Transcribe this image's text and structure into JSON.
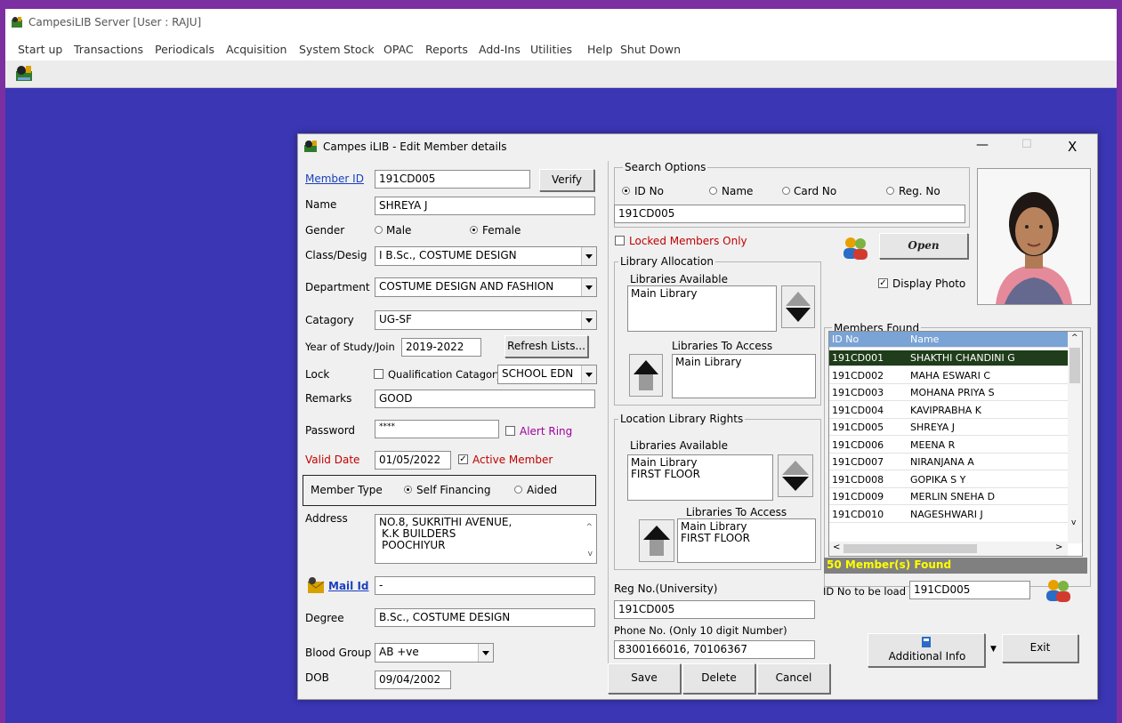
{
  "app": {
    "title": "CampesiLIB Server  [User : RAJU]"
  },
  "menu": [
    "Start up",
    "Transactions",
    "Periodicals",
    "Acquisition",
    "System",
    "Stock",
    "OPAC",
    "Reports",
    "Add-Ins",
    "Utilities",
    "Help",
    "Shut Down"
  ],
  "dialog": {
    "title": "Campes iLIB - Edit Member details",
    "window_controls": {
      "minimize": "—",
      "maximize": "☐",
      "close": "X"
    }
  },
  "form": {
    "member_id_label": "Member ID",
    "member_id": "191CD005",
    "verify_button": "Verify",
    "name_label": "Name",
    "name": "SHREYA  J",
    "gender_label": "Gender",
    "gender_options": [
      "Male",
      "Female"
    ],
    "gender_selected": "Female",
    "class_label": "Class/Desig",
    "class_value": "I B.Sc., COSTUME DESIGN",
    "department_label": "Department",
    "department_value": "COSTUME DESIGN AND FASHION",
    "category_label": "Catagory",
    "category_value": "UG-SF",
    "year_label": "Year of Study/Join",
    "year_value": "2019-2022",
    "refresh_button": "Refresh Lists...",
    "lock_label": "Lock",
    "qualification_label": "Qualification Catagory",
    "qualification_value": "SCHOOL EDN",
    "remarks_label": "Remarks",
    "remarks_value": "GOOD",
    "password_label": "Password",
    "password_value": "****",
    "alert_ring_label": "Alert Ring",
    "valid_date_label": "Valid Date",
    "valid_date_value": "01/05/2022",
    "active_member_label": "Active Member",
    "member_type_label": "Member Type",
    "member_type_options": [
      "Self Financing",
      "Aided"
    ],
    "member_type_selected": "Self Financing",
    "address_label": "Address",
    "address_lines": [
      "NO.8, SUKRITHI AVENUE,",
      "K.K BUILDERS",
      "POOCHIYUR"
    ],
    "mail_label": "Mail Id",
    "mail_value": "-",
    "degree_label": "Degree",
    "degree_value": "B.Sc., COSTUME DESIGN",
    "blood_label": "Blood Group",
    "blood_value": "AB +ve",
    "dob_label": "DOB",
    "dob_value": "09/04/2002"
  },
  "search": {
    "group_title": "Search Options",
    "options": [
      "ID No",
      "Name",
      "Card No",
      "Reg. No"
    ],
    "selected": "ID No",
    "query": "191CD005",
    "locked_only_label": "Locked Members Only",
    "open_button": "Open",
    "display_photo_label": "Display Photo"
  },
  "library_allocation": {
    "group_title": "Library Allocation",
    "available_label": "Libraries Available",
    "available": [
      "Main Library"
    ],
    "access_label": "Libraries To Access",
    "access": [
      "Main Library"
    ]
  },
  "location_rights": {
    "group_title": "Location Library Rights",
    "available_label": "Libraries Available",
    "available": [
      "Main Library",
      "FIRST FLOOR"
    ],
    "access_label": "Libraries To Access",
    "access": [
      "Main Library",
      "FIRST FLOOR"
    ]
  },
  "reg_no_label": "Reg No.(University)",
  "reg_no_value": "191CD005",
  "phone_label": "Phone No. (Only 10 digit Number)",
  "phone_value": "8300166016, 70106367",
  "buttons": {
    "save": "Save",
    "delete": "Delete",
    "cancel": "Cancel",
    "additional_info": "Additional Info",
    "exit": "Exit"
  },
  "members": {
    "group_title": "Members Found",
    "columns": [
      "ID No",
      "Name"
    ],
    "rows": [
      [
        "191CD001",
        "SHAKTHI CHANDINI G"
      ],
      [
        "191CD002",
        "MAHA ESWARI C"
      ],
      [
        "191CD003",
        "MOHANA PRIYA S"
      ],
      [
        "191CD004",
        "KAVIPRABHA K"
      ],
      [
        "191CD005",
        "SHREYA  J"
      ],
      [
        "191CD006",
        "MEENA R"
      ],
      [
        "191CD007",
        "NIRANJANA A"
      ],
      [
        "191CD008",
        "GOPIKA S Y"
      ],
      [
        "191CD009",
        "MERLIN SNEHA D"
      ],
      [
        "191CD010",
        "NAGESHWARI J"
      ]
    ],
    "selected_row": 0,
    "found_text": "50 Member(s) Found",
    "id_to_load_label": "ID No to be load",
    "id_to_load_value": "191CD005"
  },
  "colors": {
    "background": "#3b36b4",
    "selected_row": "#1f3d1a",
    "found_bar": "#808080",
    "found_text": "#ffff00"
  }
}
